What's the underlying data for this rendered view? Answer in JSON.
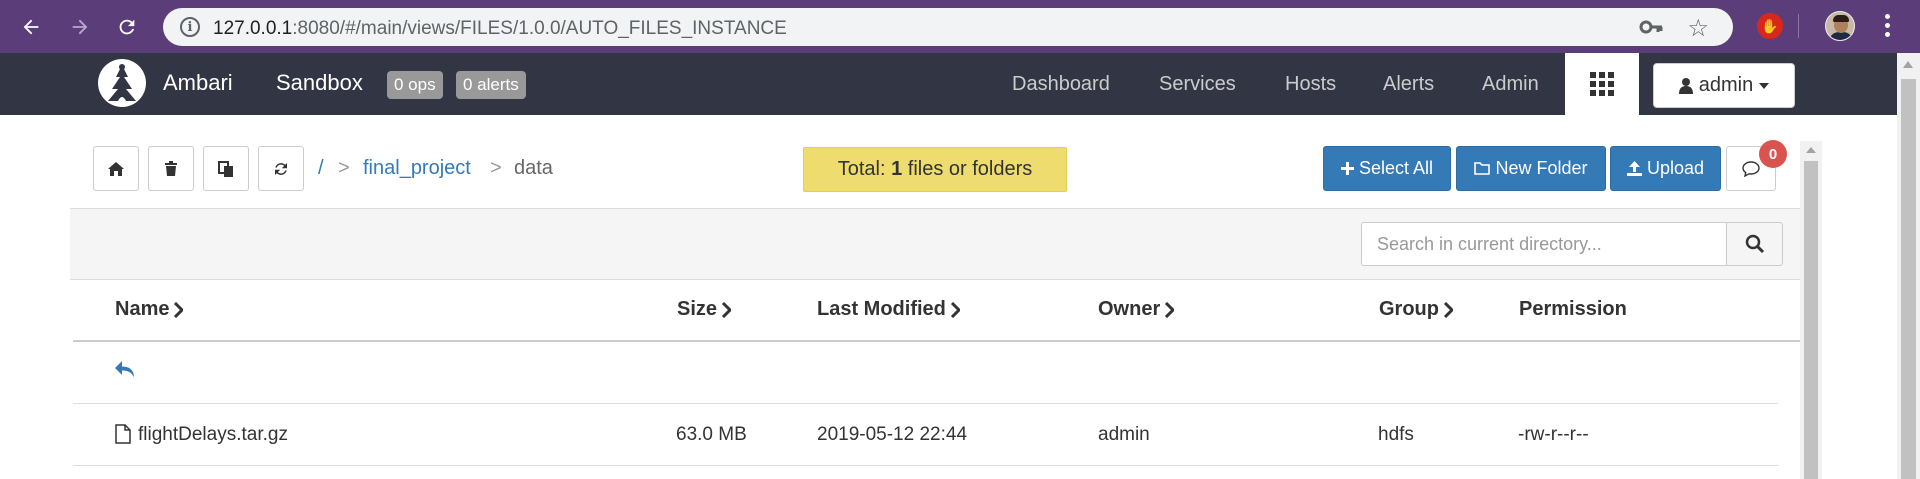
{
  "browser": {
    "url_host": "127.0.0.1",
    "url_rest": ":8080/#/main/views/FILES/1.0.0/AUTO_FILES_INSTANCE",
    "icons": [
      "back-arrow-icon",
      "forward-arrow-icon",
      "reload-icon",
      "info-icon",
      "key-icon",
      "star-icon",
      "extension-hand-icon",
      "profile-avatar",
      "menu-dots-icon"
    ]
  },
  "navbar": {
    "brand": "Ambari",
    "cluster": "Sandbox",
    "ops_badge": "0 ops",
    "alerts_badge": "0 alerts",
    "items": [
      "Dashboard",
      "Services",
      "Hosts",
      "Alerts",
      "Admin"
    ],
    "user": "admin",
    "colors": {
      "background": "#323544",
      "badge": "#999999"
    }
  },
  "toolbar": {
    "breadcrumb": {
      "root": "/",
      "sep1": ">",
      "folder": "final_project",
      "sep2": ">",
      "current": "data"
    },
    "total": {
      "prefix": "Total: ",
      "count": "1",
      "suffix": " files or folders"
    },
    "select_all": "Select All",
    "new_folder": "New Folder",
    "upload": "Upload",
    "messages_count": "0",
    "colors": {
      "primary": "#337ab7",
      "total_bg": "#efdc6e",
      "badge": "#d9534f"
    }
  },
  "search": {
    "placeholder": "Search in current directory..."
  },
  "table": {
    "columns": [
      "Name",
      "Size",
      "Last Modified",
      "Owner",
      "Group",
      "Permission"
    ],
    "rows": [
      {
        "name": "flightDelays.tar.gz",
        "size": "63.0 MB",
        "modified": "2019-05-12 22:44",
        "owner": "admin",
        "group": "hdfs",
        "permission": "-rw-r--r--"
      }
    ]
  }
}
